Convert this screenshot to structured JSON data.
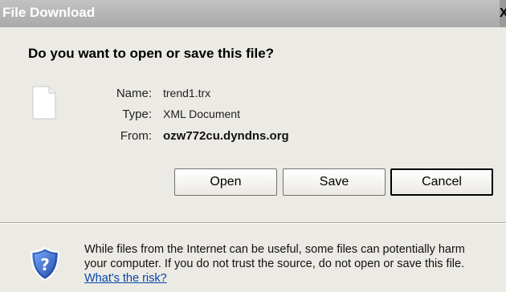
{
  "window": {
    "title": "File Download",
    "close_glyph": "X"
  },
  "question": "Do you want to open or save this file?",
  "file_icon": "blank-document-icon",
  "file": {
    "name_label": "Name:",
    "name_value": "trend1.trx",
    "type_label": "Type:",
    "type_value": "XML Document",
    "from_label": "From:",
    "from_value": "ozw772cu.dyndns.org"
  },
  "buttons": {
    "open_label": "Open",
    "save_label": "Save",
    "cancel_label": "Cancel"
  },
  "warning": {
    "icon": "shield-question-icon",
    "line1": "While files from the Internet can be useful, some files can potentially harm",
    "line2": "your computer. If you do not trust the source, do not open or save this file.",
    "link_text": "What's the risk?"
  },
  "colors": {
    "titlebar": "#a9a9a9",
    "background": "#eceae4",
    "link": "#0645ad",
    "shield_blue": "#2f5db8"
  }
}
